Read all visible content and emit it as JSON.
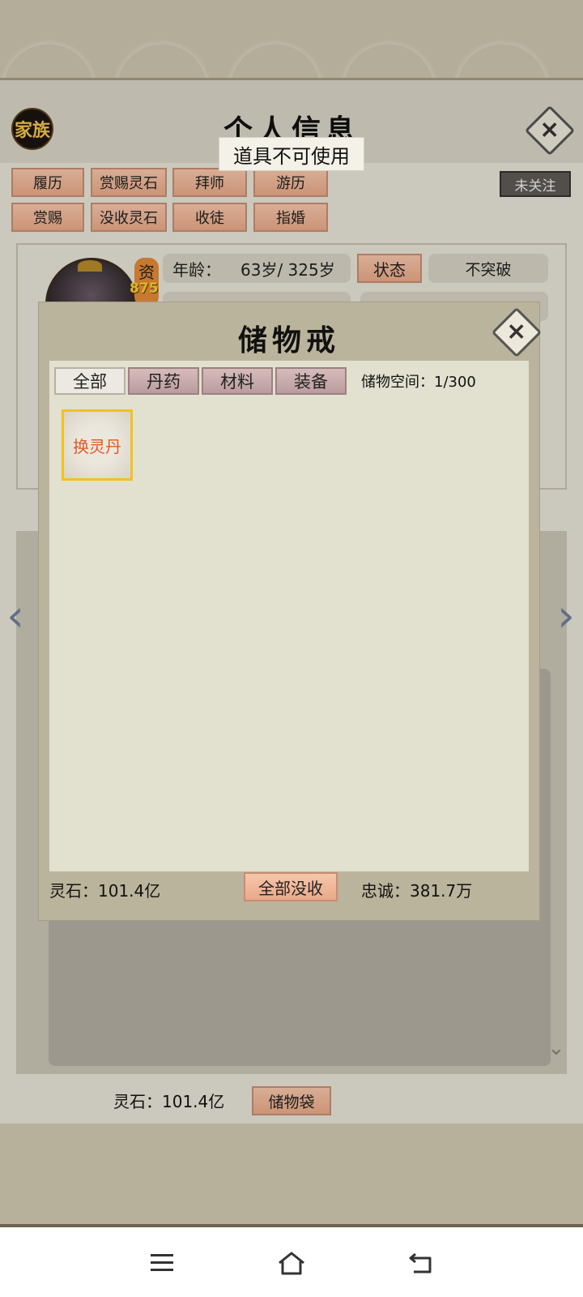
{
  "header": {
    "family_label": "家族",
    "title": "个人信息",
    "follow_label": "未关注"
  },
  "toast": {
    "text": "道具不可使用"
  },
  "actions": {
    "row1": [
      "履历",
      "赏赐灵石",
      "拜师",
      "游历"
    ],
    "row2": [
      "赏赐",
      "没收灵石",
      "收徒",
      "指婚"
    ]
  },
  "profile": {
    "zi_label": "资",
    "zi_value": "875",
    "age_label": "年龄：",
    "age_value": "63岁/ 325岁",
    "status_label": "状态",
    "breakthrough": "不突破"
  },
  "modal": {
    "title": "储物戒",
    "tabs": [
      "全部",
      "丹药",
      "材料",
      "装备"
    ],
    "active_tab": "全部",
    "capacity": "储物空间：1/300",
    "items": [
      {
        "name": "换灵丹",
        "color": "#e05a26"
      }
    ],
    "stone": "灵石：101.4亿",
    "confiscate_all": "全部没收",
    "loyalty": "忠诚：381.7万"
  },
  "footer": {
    "stone": "灵石：101.4亿",
    "bag": "储物袋"
  },
  "icons": {
    "prev": "chevron-left-icon",
    "next": "chevron-right-icon",
    "menu": "menu-icon",
    "home": "home-icon",
    "back": "back-icon"
  }
}
